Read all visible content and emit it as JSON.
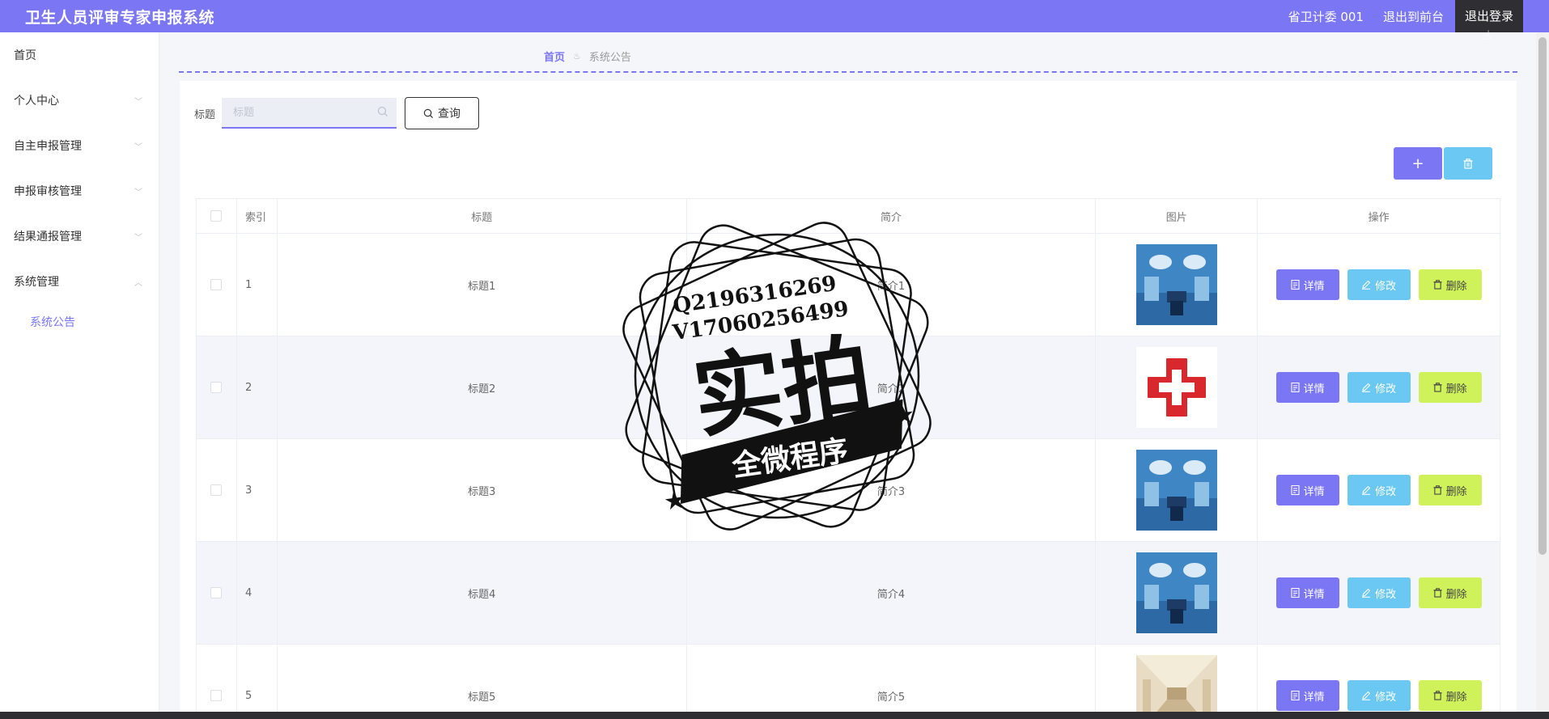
{
  "app": {
    "title": "卫生人员评审专家申报系统"
  },
  "header": {
    "user": "省卫计委 001",
    "to_frontend": "退出到前台",
    "logout": "退出登录"
  },
  "sidebar": {
    "items": [
      {
        "label": "首页"
      },
      {
        "label": "个人中心"
      },
      {
        "label": "自主申报管理"
      },
      {
        "label": "申报审核管理"
      },
      {
        "label": "结果通报管理"
      },
      {
        "label": "系统管理"
      }
    ],
    "sub_items": [
      {
        "label": "系统公告"
      }
    ]
  },
  "breadcrumb": {
    "home": "首页",
    "current": "系统公告"
  },
  "search": {
    "label": "标题",
    "placeholder": "标题",
    "value": "",
    "button": "查询"
  },
  "table": {
    "headers": {
      "index": "索引",
      "title": "标题",
      "brief": "简介",
      "image": "图片",
      "ops": "操作"
    },
    "rows": [
      {
        "index": "1",
        "title": "标题1",
        "brief": "简介1",
        "image": "operating-room"
      },
      {
        "index": "2",
        "title": "标题2",
        "brief": "简介2",
        "image": "red-cross"
      },
      {
        "index": "3",
        "title": "标题3",
        "brief": "简介3",
        "image": "operating-room"
      },
      {
        "index": "4",
        "title": "标题4",
        "brief": "简介4",
        "image": "operating-room"
      },
      {
        "index": "5",
        "title": "标题5",
        "brief": "简介5",
        "image": "hospital-corridor"
      }
    ],
    "actions": {
      "detail": "详情",
      "edit": "修改",
      "delete": "删除"
    }
  },
  "watermark": {
    "line1": "Q2196316269",
    "line2": "V17060256499",
    "main": "实拍",
    "banner": "全微程序"
  },
  "colors": {
    "primary": "#7b76f4",
    "info": "#6ac8f3",
    "danger": "#cff25a",
    "dark": "#2f2f33"
  }
}
